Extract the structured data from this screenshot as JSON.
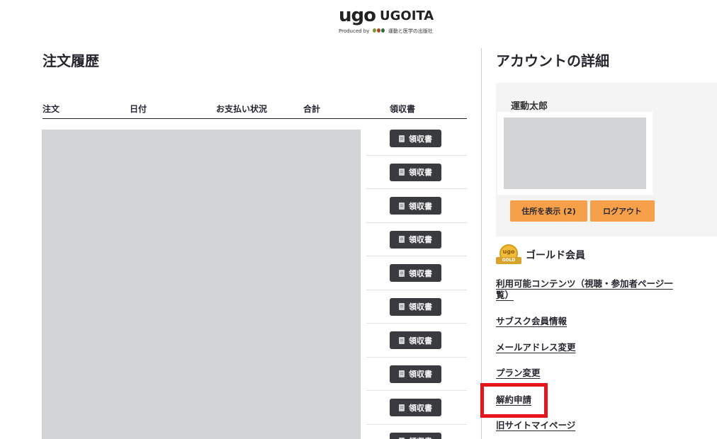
{
  "header": {
    "logo_mark": "ugo",
    "logo_name": "UGOITA",
    "logo_sub_prefix": "Produced by",
    "logo_sub_suffix": "運動と医学の出版社"
  },
  "orders": {
    "title": "注文履歴",
    "columns": [
      "注文",
      "日付",
      "お支払い状況",
      "合計",
      "領収書"
    ],
    "receipt_label": "領収書",
    "receipt_rows": 10
  },
  "account": {
    "title": "アカウントの詳細",
    "name": "運動太郎",
    "show_address_label": "住所を表示 (2)",
    "logout_label": "ログアウト",
    "membership": {
      "badge_text": "ugo",
      "badge_ribbon": "GOLD",
      "label": "ゴールド会員"
    },
    "links": {
      "contents": "利用可能コンテンツ（視聴・参加者ページ一覧）",
      "subscribe": "サブスク会員情報",
      "email": "メールアドレス変更",
      "plan": "プラン変更",
      "cancel": "解約申請",
      "old_site": "旧サイトマイページ"
    }
  },
  "colors": {
    "accent_orange": "#f6a04a",
    "highlight_red": "#e8141b",
    "receipt_button": "#3a3b3f"
  }
}
